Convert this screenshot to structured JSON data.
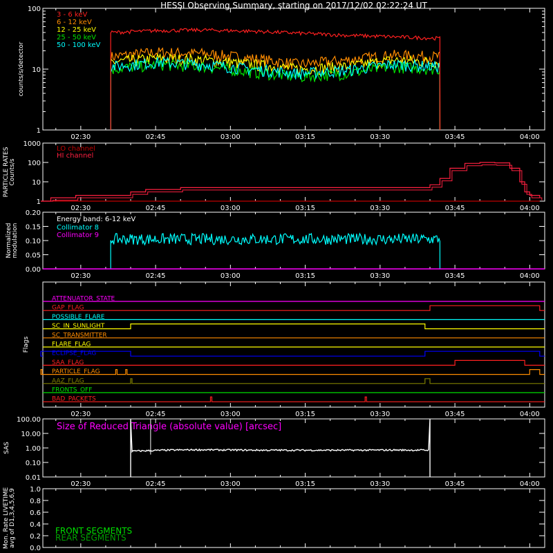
{
  "title": "HESSI Observing Summary, starting on 2017/12/02 02:22:24 UT",
  "time_ticks": [
    "02:30",
    "02:45",
    "03:00",
    "03:15",
    "03:30",
    "03:45",
    "04:00"
  ],
  "chart_data": [
    {
      "type": "line",
      "id": "count-rates",
      "ylabel": "counts/s/detector",
      "yscale": "log",
      "ylim": [
        1,
        100
      ],
      "yticks": [
        "1",
        "10",
        "100"
      ],
      "series": [
        {
          "name": "3 - 6 keV",
          "color": "#ff2020",
          "start": "02:36",
          "end": "03:42",
          "values": [
            40,
            43,
            44,
            42,
            39,
            36,
            34,
            32
          ]
        },
        {
          "name": "6 - 12 keV",
          "color": "#ff8c00",
          "start": "02:36",
          "end": "03:42",
          "values": [
            16,
            19,
            18,
            15,
            12,
            14,
            17,
            16
          ]
        },
        {
          "name": "12 - 25 keV",
          "color": "#ffff00",
          "start": "02:36",
          "end": "03:42",
          "values": [
            13,
            15,
            14,
            12,
            10,
            11,
            14,
            13
          ]
        },
        {
          "name": "25 - 50 keV",
          "color": "#00e000",
          "start": "02:36",
          "end": "03:42",
          "values": [
            10,
            12,
            11,
            9,
            7.5,
            8.5,
            11,
            10
          ]
        },
        {
          "name": "50 - 100 keV",
          "color": "#00ffff",
          "start": "02:36",
          "end": "03:42",
          "values": [
            11,
            13,
            12,
            10,
            8.5,
            9.5,
            12,
            11
          ]
        }
      ]
    },
    {
      "type": "line",
      "id": "particle-rates",
      "ylabel": "PARTICLE RATES",
      "ylabel2": "Counts/s",
      "yscale": "log",
      "ylim": [
        1,
        1000
      ],
      "yticks": [
        "1",
        "10",
        "100",
        "1000"
      ],
      "series": [
        {
          "name": "LO channel",
          "color": "#c00000",
          "points": [
            [
              "02:22",
              1
            ],
            [
              "03:50",
              1
            ],
            [
              "04:02",
              1
            ]
          ]
        },
        {
          "name": "HI channel",
          "color": "#ff2040",
          "points": [
            [
              "02:22",
              1
            ],
            [
              "02:24",
              1.5
            ],
            [
              "02:27",
              1.5
            ],
            [
              "02:29",
              2
            ],
            [
              "02:36",
              2
            ],
            [
              "02:40",
              3
            ],
            [
              "02:43",
              4
            ],
            [
              "02:50",
              5
            ],
            [
              "03:00",
              5
            ],
            [
              "03:15",
              5
            ],
            [
              "03:30",
              5
            ],
            [
              "03:37",
              5
            ],
            [
              "03:40",
              7
            ],
            [
              "03:42",
              15
            ],
            [
              "03:44",
              50
            ],
            [
              "03:47",
              90
            ],
            [
              "03:50",
              100
            ],
            [
              "03:53",
              95
            ],
            [
              "03:56",
              50
            ],
            [
              "03:58",
              10
            ],
            [
              "03:59",
              3
            ],
            [
              "04:00",
              2
            ],
            [
              "04:02",
              1.5
            ]
          ]
        }
      ]
    },
    {
      "type": "line",
      "id": "modulation",
      "ylabel": "Normalized",
      "ylabel2": "modulation",
      "ylim": [
        0,
        0.2
      ],
      "yticks": [
        "0.00",
        "0.05",
        "0.10",
        "0.15",
        "0.20"
      ],
      "annotation": "Energy band: 6-12 keV",
      "series": [
        {
          "name": "Collimator 8",
          "color": "#00ffff",
          "start": "02:36",
          "end": "03:42",
          "mean": 0.105,
          "spread": 0.02
        },
        {
          "name": "Collimator 9",
          "color": "#ff00ff",
          "constant": 0.0
        }
      ]
    },
    {
      "type": "line",
      "id": "flags",
      "ylabel": "Flags",
      "flags": [
        {
          "name": "ATTENUATOR_STATE",
          "color": "#ff00ff",
          "high": []
        },
        {
          "name": "GAP_FLAG",
          "color": "#ff2020",
          "high": [
            [
              "03:40",
              "04:02"
            ]
          ]
        },
        {
          "name": "POSSIBLE_FLARE",
          "color": "#00ffff",
          "high": []
        },
        {
          "name": "SC_IN_SUNLIGHT",
          "color": "#ffff00",
          "high": [
            [
              "02:40",
              "03:39"
            ]
          ]
        },
        {
          "name": "SC_TRANSMITTER",
          "color": "#ff8c00",
          "high": []
        },
        {
          "name": "FLARE_FLAG",
          "color": "#ffff00",
          "high": []
        },
        {
          "name": "ECLIPSE_FLAG",
          "color": "#0000ff",
          "high": [
            [
              "02:22",
              "02:40"
            ],
            [
              "03:39",
              "04:02"
            ]
          ]
        },
        {
          "name": "SAA_FLAG",
          "color": "#ff2020",
          "high": [
            [
              "03:45",
              "03:59"
            ]
          ]
        },
        {
          "name": "PARTICLE_FLAG",
          "color": "#ff8c00",
          "high": [
            [
              "02:22",
              "02:22"
            ],
            [
              "02:37",
              "02:37"
            ],
            [
              "02:39",
              "02:39"
            ],
            [
              "04:00",
              "04:02"
            ]
          ]
        },
        {
          "name": "AAZ_FLAG",
          "color": "#808000",
          "high": [
            [
              "02:40",
              "02:40"
            ],
            [
              "03:39",
              "03:40"
            ]
          ]
        },
        {
          "name": "FRONTS_OFF",
          "color": "#00e000",
          "high": []
        },
        {
          "name": "BAD_PACKETS",
          "color": "#ff2020",
          "high": [
            [
              "02:56",
              "02:56"
            ],
            [
              "03:27",
              "03:27"
            ]
          ]
        }
      ]
    },
    {
      "type": "line",
      "id": "sas",
      "ylabel": "SAS",
      "yscale": "log",
      "ylim": [
        0.01,
        100
      ],
      "yticks": [
        "0.01",
        "0.10",
        "1.00",
        "10.00",
        "100.00"
      ],
      "annotation": "Size of Reduced Triangle (absolute value) [arcsec]",
      "series": [
        {
          "name": "",
          "color": "#ffffff",
          "start": "02:40",
          "end": "03:40",
          "values": [
            0.6,
            0.7,
            0.75,
            0.72,
            0.7,
            0.7,
            0.7,
            0.7,
            0.72,
            0.7
          ]
        }
      ]
    },
    {
      "type": "line",
      "id": "livetime",
      "ylabel": "Mon. Rate LIVETIME",
      "ylabel2": "avg of D1,3,4,5,6,9",
      "ylim": [
        0,
        1
      ],
      "yticks": [
        "0.0",
        "0.2",
        "0.4",
        "0.6",
        "0.8",
        "1.0"
      ],
      "legend": [
        {
          "name": "FRONT SEGMENTS",
          "color": "#00e000"
        },
        {
          "name": "REAR SEGMENTS",
          "color": "#00a000"
        }
      ]
    }
  ]
}
